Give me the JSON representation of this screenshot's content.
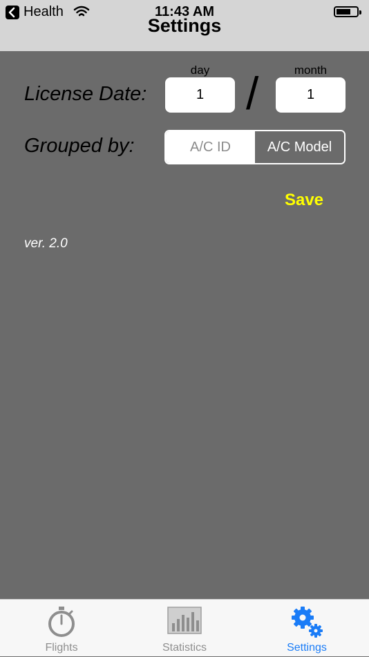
{
  "status_bar": {
    "back_app": "Health",
    "time": "11:43 AM"
  },
  "nav": {
    "title": "Settings"
  },
  "license_date": {
    "label": "License Date:",
    "day_label": "day",
    "day_value": "1",
    "separator": "/",
    "month_label": "month",
    "month_value": "1"
  },
  "grouped_by": {
    "label": "Grouped by:",
    "options": [
      "A/C ID",
      "A/C Model"
    ],
    "selected": "A/C ID"
  },
  "save_label": "Save",
  "version": "ver. 2.0",
  "tab_bar": {
    "tabs": [
      {
        "label": "Flights",
        "icon": "stopwatch-icon",
        "active": false
      },
      {
        "label": "Statistics",
        "icon": "bar-chart-icon",
        "active": false
      },
      {
        "label": "Settings",
        "icon": "gears-icon",
        "active": true
      }
    ]
  },
  "colors": {
    "background": "#6b6b6b",
    "status_bar": "#d5d5d5",
    "save": "#ffff00",
    "tab_active": "#1a7cf7",
    "tab_inactive": "#8e8e8e"
  }
}
